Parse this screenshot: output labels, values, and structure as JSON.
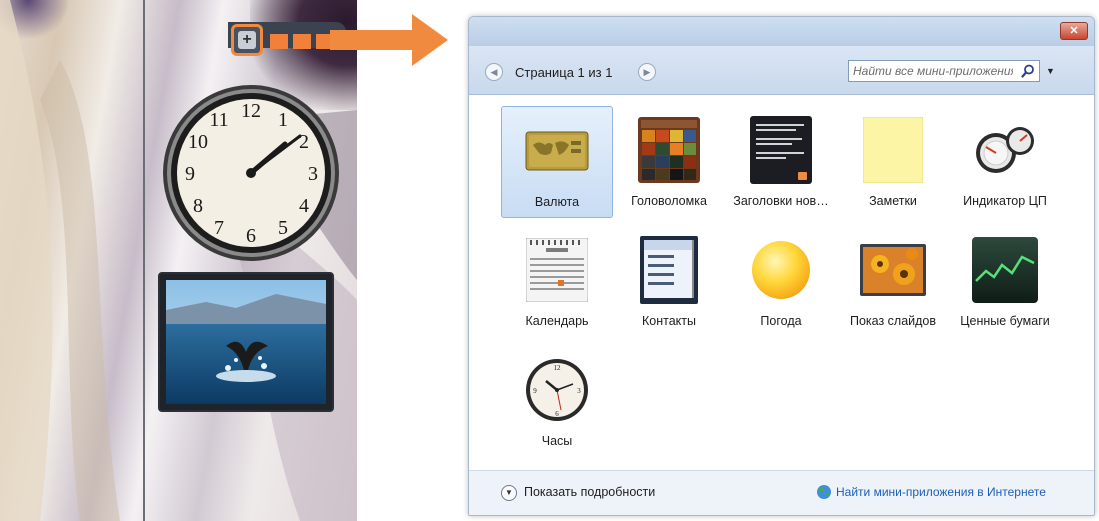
{
  "colors": {
    "accent_orange": "#f08a3e",
    "titlebar_blue": "#b9cde6",
    "selection_blue": "#c8dcf4",
    "link_blue": "#1d5fb8",
    "close_red": "#c8462e"
  },
  "sidebar": {
    "add_button_icon": "plus-icon"
  },
  "gallery": {
    "close_icon": "close-icon",
    "nav": {
      "prev_icon": "chevron-left-icon",
      "next_icon": "chevron-right-icon",
      "page_label": "Страница 1 из 1"
    },
    "search": {
      "placeholder": "Найти все мини-приложения",
      "icon": "search-icon",
      "dropdown_icon": "chevron-down-icon"
    },
    "gadgets": [
      {
        "label": "Валюта",
        "icon": "currency-icon",
        "selected": true
      },
      {
        "label": "Головоломка",
        "icon": "puzzle-icon",
        "selected": false
      },
      {
        "label": "Заголовки нов…",
        "icon": "news-headlines-icon",
        "selected": false
      },
      {
        "label": "Заметки",
        "icon": "notes-icon",
        "selected": false
      },
      {
        "label": "Индикатор ЦП",
        "icon": "cpu-meter-icon",
        "selected": false
      },
      {
        "label": "Календарь",
        "icon": "calendar-icon",
        "selected": false
      },
      {
        "label": "Контакты",
        "icon": "contacts-icon",
        "selected": false
      },
      {
        "label": "Погода",
        "icon": "weather-icon",
        "selected": false
      },
      {
        "label": "Показ слайдов",
        "icon": "slideshow-icon",
        "selected": false
      },
      {
        "label": "Ценные бумаги",
        "icon": "stocks-icon",
        "selected": false
      },
      {
        "label": "Часы",
        "icon": "clock-icon",
        "selected": false
      }
    ],
    "footer": {
      "details_icon": "chevron-down-icon",
      "details_label": "Показать подробности",
      "online_icon": "globe-icon",
      "online_link": "Найти мини-приложения в Интернете"
    }
  }
}
